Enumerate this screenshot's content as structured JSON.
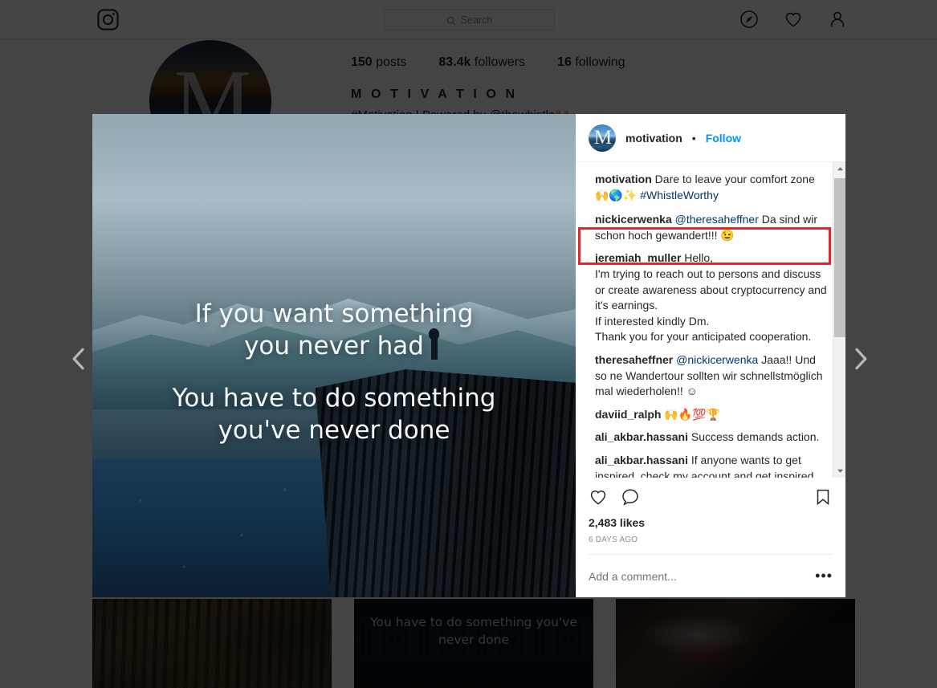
{
  "navbar": {
    "logo_icon": "instagram-logo-icon",
    "search": {
      "placeholder": "Search",
      "icon": "search-icon"
    },
    "icons": [
      {
        "name": "explore-compass-icon"
      },
      {
        "name": "activity-heart-icon"
      },
      {
        "name": "profile-person-icon"
      }
    ]
  },
  "profile": {
    "avatar_letter": "M",
    "posts_count": "150",
    "posts_label": "posts",
    "followers_count": "83.4k",
    "followers_label": "followers",
    "following_count": "16",
    "following_label": "following",
    "display_name": "M O T I V A T I O N",
    "bio_plain": "#Motivation | Powered by ",
    "bio_mention": "@thewhistle",
    "bio_emoji": "🙌"
  },
  "grid": {
    "thumb2_quote": "You have to do something\nyou've never done"
  },
  "carousel": {
    "prev_label": "‹",
    "next_label": "›"
  },
  "modal": {
    "image": {
      "avatar_letter": "M",
      "quote_line1": "If you want something",
      "quote_line2": "you never had",
      "quote_line3": "You have to do something",
      "quote_line4": "you've never done"
    },
    "header": {
      "username": "motivation",
      "separator": "•",
      "follow_label": "Follow"
    },
    "caption": {
      "username": "motivation",
      "text": "Dare to leave your comfort zone",
      "emoji": "🙌🌎✨",
      "hashtag": "#WhistleWorthy"
    },
    "comments": [
      {
        "username": "nickicerwenka",
        "mention": "@theresaheffner",
        "text": "Da sind wir schon hoch gewandert!!! 😉"
      },
      {
        "username": "jeremiah_muller",
        "mention": "",
        "text": "Hello,\nI'm trying to reach out to persons and discuss or create awareness about cryptocurrency and it's earnings.\nIf interested kindly Dm.\nThank you for your anticipated cooperation."
      },
      {
        "username": "theresaheffner",
        "mention": "@nickicerwenka",
        "text": "Jaaa!! Und so ne Wandertour sollten wir schnellstmöglich mal wiederholen!! ☺"
      },
      {
        "username": "daviid_ralph",
        "mention": "",
        "text": "🙌🔥💯🏆"
      },
      {
        "username": "ali_akbar.hassani",
        "mention": "",
        "text": "Success demands action."
      },
      {
        "username": "ali_akbar.hassani",
        "mention": "",
        "text": "If anyone wants to get inspired, check my account and get inspired. Or lis. Lhanks again."
      }
    ],
    "actions": {
      "like_icon": "heart-icon",
      "comment_icon": "comment-bubble-icon",
      "save_icon": "bookmark-icon"
    },
    "likes": "2,483 likes",
    "timestamp": "6 DAYS AGO",
    "add_comment_placeholder": "Add a comment...",
    "more_label": "•••"
  },
  "annotation": {
    "highlight_color": "#e8242a"
  }
}
